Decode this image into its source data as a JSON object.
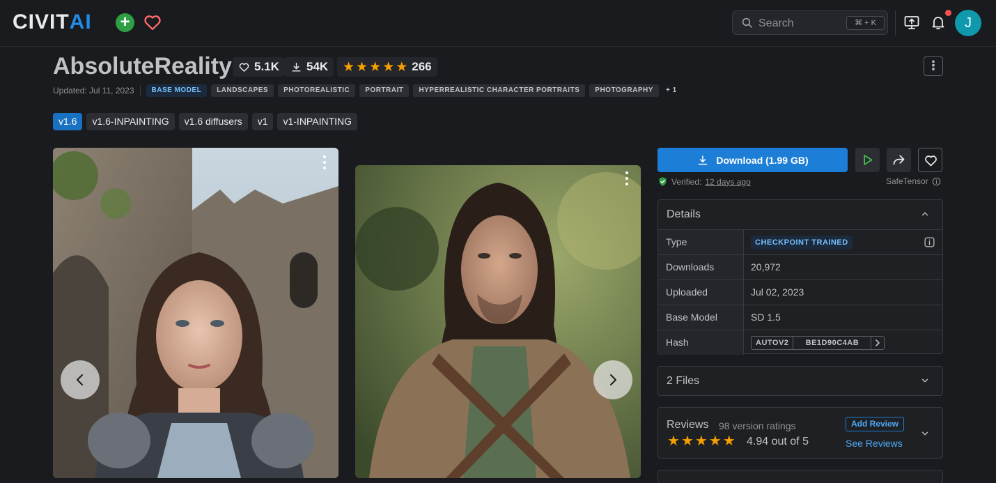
{
  "header": {
    "logo_left": "CIVIT",
    "logo_right": "AI",
    "search_placeholder": "Search",
    "search_shortcut": "⌘ + K",
    "avatar_initial": "J",
    "colors": {
      "accent": "#228be6",
      "create": "#2f9e44",
      "notification_dot": "#fa5252",
      "avatar": "#1098ad"
    }
  },
  "model": {
    "title": "AbsoluteReality",
    "likes": "5.1K",
    "downloads": "54K",
    "rating_count": "266",
    "stars": 5,
    "updated": "Updated: Jul 11, 2023",
    "base_tag": "BASE MODEL",
    "tags": [
      "LANDSCAPES",
      "PHOTOREALISTIC",
      "PORTRAIT",
      "HYPERREALISTIC CHARACTER PORTRAITS",
      "PHOTOGRAPHY"
    ],
    "more_tags": "+ 1"
  },
  "versions": [
    {
      "label": "v1.6",
      "active": true
    },
    {
      "label": "v1.6-INPAINTING",
      "active": false
    },
    {
      "label": "v1.6 diffusers",
      "active": false
    },
    {
      "label": "v1",
      "active": false
    },
    {
      "label": "v1-INPAINTING",
      "active": false
    }
  ],
  "actions": {
    "download_label": "Download (1.99 GB)",
    "verified_prefix": "Verified:",
    "verified_when": "12 days ago",
    "format": "SafeTensor"
  },
  "details": {
    "heading": "Details",
    "type_label": "Type",
    "type_value": "CHECKPOINT TRAINED",
    "downloads_label": "Downloads",
    "downloads_value": "20,972",
    "uploaded_label": "Uploaded",
    "uploaded_value": "Jul 02, 2023",
    "base_model_label": "Base Model",
    "base_model_value": "SD 1.5",
    "hash_label": "Hash",
    "hash_type": "AUTOV2",
    "hash_value": "BE1D90C4AB"
  },
  "files": {
    "heading": "2 Files"
  },
  "reviews": {
    "heading": "Reviews",
    "count": "98 version ratings",
    "score": "4.94 out of 5",
    "add_label": "Add Review",
    "see_label": "See Reviews",
    "stars": 5
  },
  "carousel": {
    "prev": "‹",
    "next": "›"
  }
}
